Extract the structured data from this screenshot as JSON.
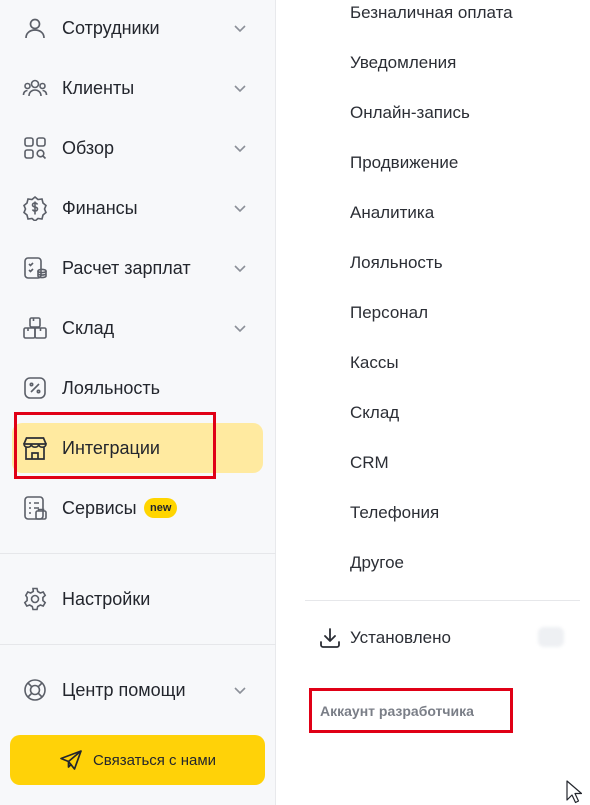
{
  "sidebar": {
    "items": [
      {
        "label": "Сотрудники",
        "icon": "user-icon",
        "has_chevron": true
      },
      {
        "label": "Клиенты",
        "icon": "clients-group-icon",
        "has_chevron": true
      },
      {
        "label": "Обзор",
        "icon": "overview-grid-icon",
        "has_chevron": true
      },
      {
        "label": "Финансы",
        "icon": "finance-dollar-icon",
        "has_chevron": true
      },
      {
        "label": "Расчет зарплат",
        "icon": "payroll-icon",
        "has_chevron": true
      },
      {
        "label": "Склад",
        "icon": "warehouse-boxes-icon",
        "has_chevron": true
      },
      {
        "label": "Лояльность",
        "icon": "loyalty-percent-icon",
        "has_chevron": false
      },
      {
        "label": "Интеграции",
        "icon": "store-icon",
        "has_chevron": false,
        "active": true
      },
      {
        "label": "Сервисы",
        "icon": "services-list-icon",
        "has_chevron": false,
        "badge": "new"
      }
    ],
    "settings": {
      "label": "Настройки",
      "icon": "gear-icon"
    },
    "help": {
      "label": "Центр помощи",
      "icon": "lifebuoy-icon"
    },
    "contact_button": {
      "label": "Связаться с нами",
      "icon": "send-plane-icon"
    }
  },
  "integrations_menu": {
    "categories": [
      "Безналичная оплата",
      "Уведомления",
      "Онлайн-запись",
      "Продвижение",
      "Аналитика",
      "Лояльность",
      "Персонал",
      "Кассы",
      "Склад",
      "CRM",
      "Телефония",
      "Другое"
    ],
    "installed": {
      "label": "Установлено",
      "icon": "download-icon"
    },
    "developer_account": "Аккаунт разработчика"
  },
  "colors": {
    "active_bg": "#ffeaa0",
    "accent_yellow": "#ffd208",
    "highlight_red": "#e00016"
  }
}
